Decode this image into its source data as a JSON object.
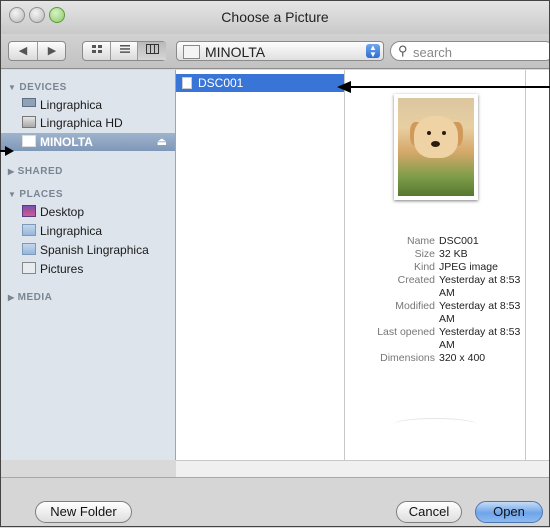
{
  "window": {
    "title": "Choose a Picture"
  },
  "toolbar": {
    "back_glyph": "◀",
    "forward_glyph": "▶",
    "location": "MINOLTA",
    "search_placeholder": "search"
  },
  "sidebar": {
    "sections": [
      {
        "label": "DEVICES",
        "expanded": true
      },
      {
        "label": "SHARED",
        "expanded": false
      },
      {
        "label": "PLACES",
        "expanded": true
      },
      {
        "label": "MEDIA",
        "expanded": false
      }
    ],
    "devices": [
      {
        "label": "Lingraphica",
        "icon": "computer-icon"
      },
      {
        "label": "Lingraphica HD",
        "icon": "hard-drive-icon"
      },
      {
        "label": "MINOLTA",
        "icon": "drive-icon",
        "selected": true
      }
    ],
    "places": [
      {
        "label": "Desktop",
        "icon": "desktop-icon"
      },
      {
        "label": "Lingraphica",
        "icon": "folder-icon"
      },
      {
        "label": "Spanish Lingraphica",
        "icon": "folder-icon"
      },
      {
        "label": "Pictures",
        "icon": "pictures-folder-icon"
      }
    ]
  },
  "browser": {
    "files": [
      {
        "name": "DSC001",
        "selected": true
      }
    ]
  },
  "preview": {
    "info": [
      {
        "key": "Name",
        "value": "DSC001"
      },
      {
        "key": "Size",
        "value": "32 KB"
      },
      {
        "key": "Kind",
        "value": "JPEG image"
      },
      {
        "key": "Created",
        "value": "Yesterday at 8:53 AM"
      },
      {
        "key": "Modified",
        "value": "Yesterday at 8:53 AM"
      },
      {
        "key": "Last opened",
        "value": "Yesterday at 8:53 AM"
      },
      {
        "key": "Dimensions",
        "value": "320 x 400"
      }
    ]
  },
  "footer": {
    "new_folder": "New Folder",
    "cancel": "Cancel",
    "open": "Open"
  },
  "colors": {
    "selection": "#3875d7",
    "sidebar_bg": "#dde4ec",
    "default_button": "#6ea5ea"
  }
}
